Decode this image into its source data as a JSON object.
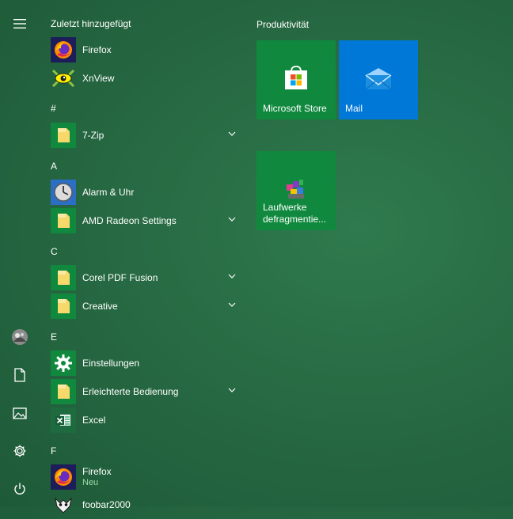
{
  "colors": {
    "tile_green": "#10893e",
    "tile_blue": "#0078d7",
    "folder_bg": "#10893e",
    "folder_yellow": "#f7d96b"
  },
  "rail": {
    "menu_icon": "hamburger-icon",
    "user_icon": "user-avatar",
    "documents_icon": "document-icon",
    "pictures_icon": "picture-icon",
    "settings_icon": "gear-icon",
    "power_icon": "power-icon"
  },
  "applist": {
    "recent_header": "Zuletzt hinzugefügt",
    "recent": [
      {
        "label": "Firefox",
        "icon": "firefox-icon"
      },
      {
        "label": "XnView",
        "icon": "xnview-icon"
      }
    ],
    "sections": [
      {
        "header": "#",
        "items": [
          {
            "label": "7-Zip",
            "icon": "folder-icon",
            "expandable": true
          }
        ]
      },
      {
        "header": "A",
        "items": [
          {
            "label": "Alarm & Uhr",
            "icon": "clock-icon",
            "expandable": false
          },
          {
            "label": "AMD Radeon Settings",
            "icon": "folder-icon",
            "expandable": true
          }
        ]
      },
      {
        "header": "C",
        "items": [
          {
            "label": "Corel PDF Fusion",
            "icon": "folder-icon",
            "expandable": true
          },
          {
            "label": "Creative",
            "icon": "folder-icon",
            "expandable": true
          }
        ]
      },
      {
        "header": "E",
        "items": [
          {
            "label": "Einstellungen",
            "icon": "gear-icon",
            "expandable": false
          },
          {
            "label": "Erleichterte Bedienung",
            "icon": "folder-icon",
            "expandable": true
          },
          {
            "label": "Excel",
            "icon": "excel-icon",
            "expandable": false
          }
        ]
      },
      {
        "header": "F",
        "items": [
          {
            "label": "Firefox",
            "badge": "Neu",
            "icon": "firefox-icon",
            "expandable": false
          },
          {
            "label": "foobar2000",
            "icon": "foobar-icon",
            "expandable": false
          }
        ]
      }
    ]
  },
  "tiles": {
    "group_title": "Produktivität",
    "items": [
      {
        "label": "Microsoft Store",
        "icon": "store-icon",
        "color": "#10893e"
      },
      {
        "label": "Mail",
        "icon": "mail-icon",
        "color": "#0078d7"
      },
      {
        "label": "Laufwerke\ndefragmentie...",
        "icon": "defrag-icon",
        "color": "#10893e"
      }
    ]
  }
}
